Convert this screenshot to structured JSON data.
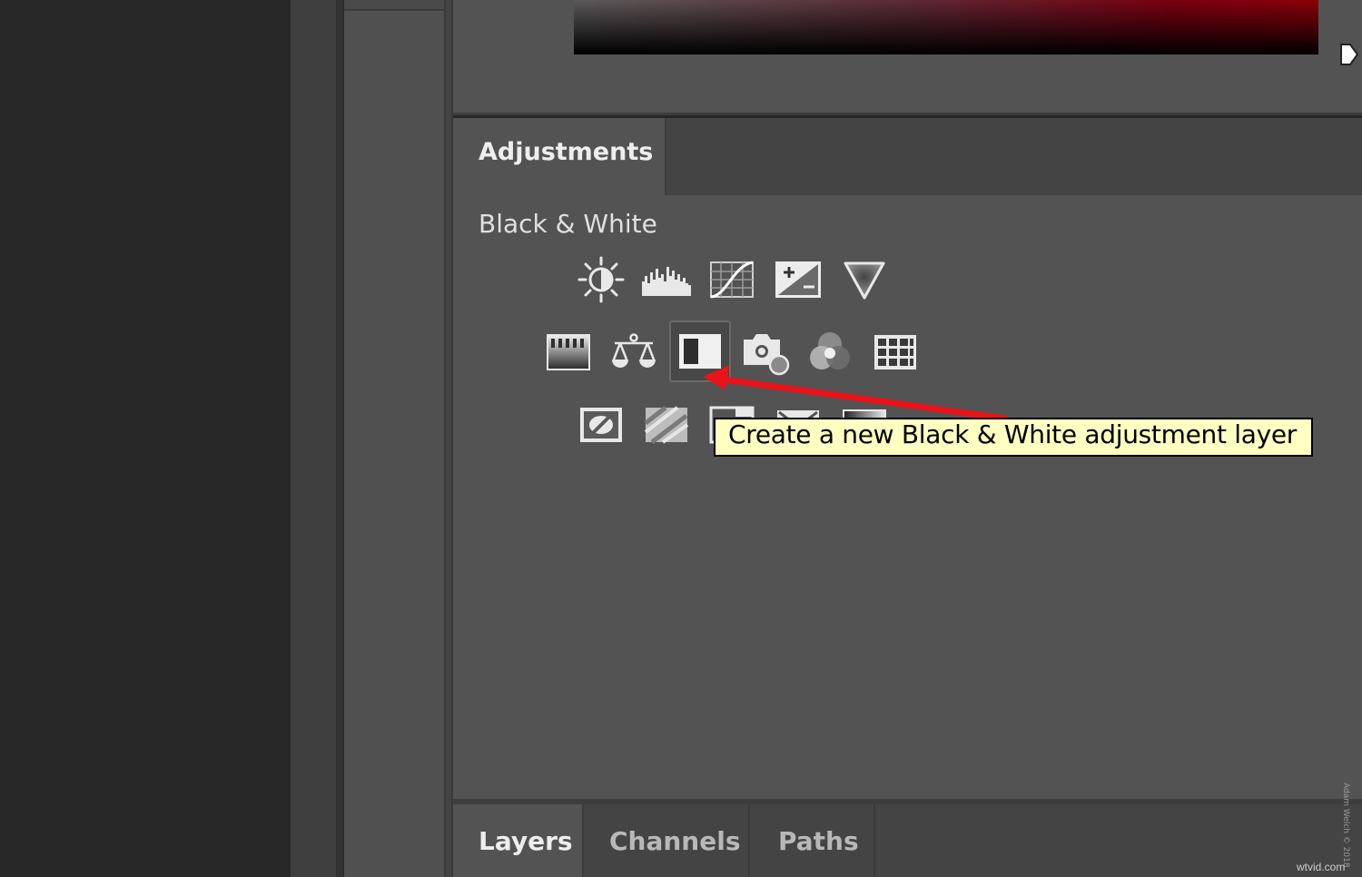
{
  "adjustments_panel": {
    "tab_label": "Adjustments",
    "subtitle": "Black & White",
    "icons_row1": [
      "brightness-contrast-icon",
      "levels-icon",
      "curves-icon",
      "exposure-icon",
      "vibrance-icon"
    ],
    "icons_row2": [
      "hue-saturation-icon",
      "color-balance-icon",
      "black-white-icon",
      "photo-filter-icon",
      "channel-mixer-icon",
      "color-lookup-icon"
    ],
    "icons_row3": [
      "invert-icon",
      "posterize-icon",
      "threshold-icon",
      "selective-color-icon",
      "gradient-map-icon"
    ],
    "selected_icon": "black-white-icon"
  },
  "tooltip": {
    "text": "Create a new Black & White adjustment layer"
  },
  "annotation": {
    "arrow_color": "#e8141a"
  },
  "bottom_panel": {
    "tabs": [
      {
        "label": "Layers",
        "active": true
      },
      {
        "label": "Channels",
        "active": false
      },
      {
        "label": "Paths",
        "active": false
      }
    ]
  },
  "watermark": {
    "site": "wtvid.com",
    "credit": "Adam Welch © 2018"
  }
}
